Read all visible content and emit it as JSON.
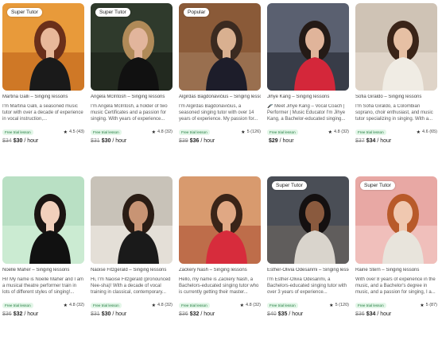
{
  "accent": {
    "trial_bg": "#e3f6e8",
    "trial_fg": "#1e7a3c"
  },
  "icons": {
    "rating": "star-icon"
  },
  "cards": [
    {
      "badge": "Super Tutor",
      "name": "Martina Galli – Singing lessons",
      "desc": "I'm Martina Galli, a seasoned music tutor with over a decade of experience in vocal instruction,...",
      "trial": "Free trial lesson",
      "rating": "4.5 (43)",
      "old_price": "$34",
      "new_price": "$30",
      "unit": "/ hour",
      "photo": {
        "bg": "#e89a3a",
        "bg2": "#c46a1e",
        "skin": "#e8b89a",
        "hair": "#6a2f1a",
        "shirt": "#1a1a1a"
      }
    },
    {
      "badge": "Super Tutor",
      "name": "Angela McIntosh – Singing lessons",
      "desc": "I'm Angela McIntosh, a holder of two music Certificates and a passion for singing. With years of experience...",
      "trial": "Free trial lesson",
      "rating": "4.8 (32)",
      "old_price": "$31",
      "new_price": "$30",
      "unit": "/ hour",
      "photo": {
        "bg": "#2f3a2c",
        "bg2": "#1c2219",
        "skin": "#e2b59c",
        "hair": "#b08a58",
        "shirt": "#111111"
      }
    },
    {
      "badge": "Popular",
      "name": "Algirdas Bagdonavičius – Singing lessons",
      "desc": "I'm Algirdas Bagdonavičius, a seasoned singing tutor with over 14 years of experience. My passion for...",
      "trial": "Free trial lesson",
      "rating": "5 (126)",
      "old_price": "$39",
      "new_price": "$36",
      "unit": "/ hour",
      "photo": {
        "bg": "#8a5a38",
        "bg2": "#a0785a",
        "skin": "#d9b090",
        "hair": "#3a2a20",
        "shirt": "#1d1d2a"
      }
    },
    {
      "badge": "",
      "name": "Jihye Kang – Singing lessons",
      "desc": "🎤 Meet Jihye Kang – Vocal Coach | Performer | Music Educator I'm Jihye Kang, a Bachelor-educated singing...",
      "trial": "Free trial lesson",
      "rating": "4.8 (32)",
      "old_price": "",
      "new_price": "$29",
      "unit": "/ hour",
      "photo": {
        "bg": "#5a6070",
        "bg2": "#2a2e38",
        "skin": "#e0b49a",
        "hair": "#241a16",
        "shirt": "#d4273a"
      }
    },
    {
      "badge": "",
      "name": "Sofia Giraldo – Singing lessons",
      "desc": "I'm Sofia Giraldo, a Colombian soprano, choir enthusiast, and music tutor specializing in singing. With a...",
      "trial": "Free trial lesson",
      "rating": "4.6 (65)",
      "old_price": "$37",
      "new_price": "$34",
      "unit": "/ hour",
      "photo": {
        "bg": "#cfc3b5",
        "bg2": "#e5dcd0",
        "skin": "#e6c0a4",
        "hair": "#3a2418",
        "shirt": "#f0ece4"
      }
    },
    {
      "badge": "",
      "name": "Noelle Maher – Singing lessons",
      "desc": "Hi! My name is Noelle Maher and I am a musical theatre performer train in lots of different styles of singing!...",
      "trial": "Free trial lesson",
      "rating": "4.8 (32)",
      "old_price": "$36",
      "new_price": "$32",
      "unit": "/ hour",
      "photo": {
        "bg": "#b9e0c4",
        "bg2": "#d3efd9",
        "skin": "#f2d0bc",
        "hair": "#1a1412",
        "shirt": "#111111"
      }
    },
    {
      "badge": "",
      "name": "Naoise Fitzgerald – Singing lessons",
      "desc": "Hi, I'm Naoise Fitzgerald (pronounced Nee-sha)! With a decade of vocal training in classical, contemporary...",
      "trial": "Free trial lesson",
      "rating": "4.8 (32)",
      "old_price": "$31",
      "new_price": "$30",
      "unit": "/ hour",
      "photo": {
        "bg": "#c8c2b8",
        "bg2": "#efebe4",
        "skin": "#c89474",
        "hair": "#2a1c14",
        "shirt": "#1a1a1a"
      }
    },
    {
      "badge": "",
      "name": "Zackery Nash – Singing lessons",
      "desc": "Hello, my name is Zackery Nash, a Bachelors-educated singing tutor who is currently getting their master...",
      "trial": "Free trial lesson",
      "rating": "4.8 (32)",
      "old_price": "$36",
      "new_price": "$32",
      "unit": "/ hour",
      "photo": {
        "bg": "#d89a6e",
        "bg2": "#b35a3a",
        "skin": "#e0a884",
        "hair": "#3a2418",
        "shirt": "#d72c3c"
      }
    },
    {
      "badge": "Super Tutor",
      "name": "Esther-Olivia Odesanmi – Singing lessons",
      "desc": "I'm Esther-Olivia Odesanmi, a Bachelors-educated singing tutor with over 3 years of experience...",
      "trial": "Free trial lesson",
      "rating": "5 (120)",
      "old_price": "$40",
      "new_price": "$35",
      "unit": "/ hour",
      "photo": {
        "bg": "#4a4e56",
        "bg2": "#6a6460",
        "skin": "#8a5a3e",
        "hair": "#141010",
        "shirt": "#d9d4cc"
      }
    },
    {
      "badge": "Super Tutor",
      "name": "Raine Stern – Singing lessons",
      "desc": "With over 8 years of experience in the music, and a Bachelor's degree in music, and a passion for singing, I a...",
      "trial": "Free trial lesson",
      "rating": "5 (87)",
      "old_price": "$36",
      "new_price": "$34",
      "unit": "/ hour",
      "photo": {
        "bg": "#e8a8a4",
        "bg2": "#f3c9c4",
        "skin": "#f0c8b0",
        "hair": "#b85a2a",
        "shirt": "#e8e4dc"
      }
    }
  ]
}
